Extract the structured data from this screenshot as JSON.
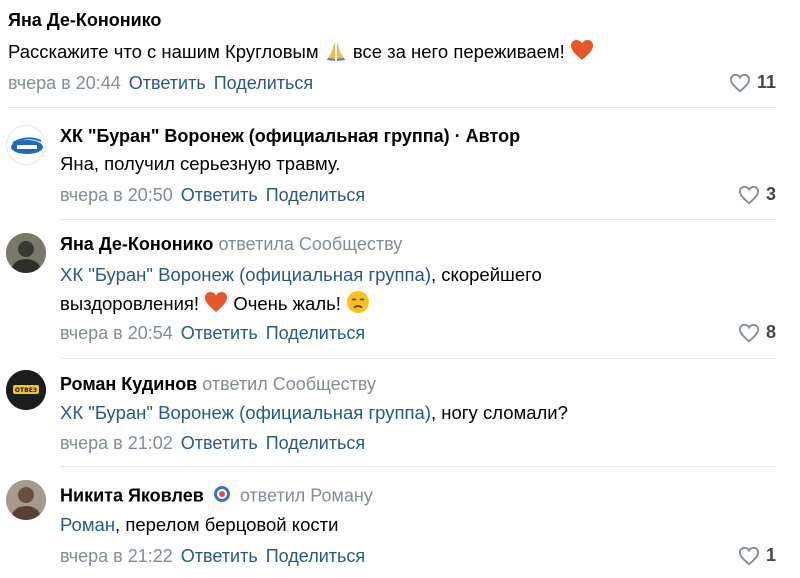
{
  "comments": [
    {
      "author": "Яна Де-Кононико",
      "text": "Расскажите что с нашим Кругловым",
      "text_after": "все за него переживаем!",
      "time": "вчера в 20:44",
      "reply_label": "Ответить",
      "share_label": "Поделиться",
      "likes": "11"
    },
    {
      "author": "ХК \"Буран\" Воронеж (официальная группа)",
      "author_suffix": "· Автор",
      "text": "Яна, получил серьезную травму.",
      "time": "вчера в 20:50",
      "reply_label": "Ответить",
      "share_label": "Поделиться",
      "likes": "3"
    },
    {
      "author": "Яна Де-Кононико",
      "replied": "ответила Сообществу",
      "reply_target": "ХК \"Буран\" Воронеж (официальная группа)",
      "text": ", скорейшего",
      "text_line2": "выздоровления!",
      "text_line2_after": "Очень жаль!",
      "time": "вчера в 20:54",
      "reply_label": "Ответить",
      "share_label": "Поделиться",
      "likes": "8"
    },
    {
      "author": "Роман Кудинов",
      "replied": "ответил Сообществу",
      "reply_target": "ХК \"Буран\" Воронеж (официальная группа)",
      "text": ", ногу сломали?",
      "time": "вчера в 21:02",
      "reply_label": "Ответить",
      "share_label": "Поделиться"
    },
    {
      "author": "Никита Яковлев",
      "replied": "ответил Роману",
      "reply_target": "Роман",
      "text": ", перелом берцовой кости",
      "time": "вчера в 21:22",
      "reply_label": "Ответить",
      "share_label": "Поделиться",
      "likes": "1"
    }
  ],
  "avatar_logo_text": "ОТВЕЗ",
  "colors": {
    "link": "#2a5885",
    "secondary": "#818c99",
    "heart_emoji": "#e8572a",
    "divider": "#e7e8ec"
  }
}
